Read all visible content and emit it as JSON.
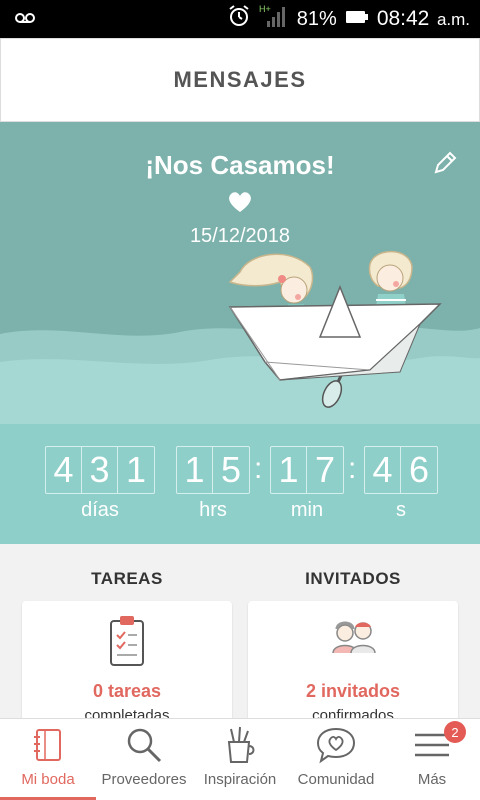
{
  "statusbar": {
    "battery": "81%",
    "time": "08:42",
    "ampm": "a.m."
  },
  "header": {
    "title": "MENSAJES"
  },
  "hero": {
    "headline": "¡Nos Casamos!",
    "date": "15/12/2018"
  },
  "countdown": {
    "days": [
      "4",
      "3",
      "1"
    ],
    "hours": [
      "1",
      "5"
    ],
    "minutes": [
      "1",
      "7"
    ],
    "seconds": [
      "4",
      "6"
    ],
    "labels": {
      "days": "días",
      "hours": "hrs",
      "minutes": "min",
      "seconds": "s"
    }
  },
  "sections": {
    "tasks": {
      "title": "TAREAS",
      "count": "0 tareas",
      "sub": "completadas"
    },
    "guests": {
      "title": "INVITADOS",
      "count": "2 invitados",
      "sub": "confirmados"
    }
  },
  "nav": {
    "items": [
      {
        "label": "Mi boda",
        "icon": "notebook-icon"
      },
      {
        "label": "Proveedores",
        "icon": "search-icon"
      },
      {
        "label": "Inspiración",
        "icon": "pencil-cup-icon"
      },
      {
        "label": "Comunidad",
        "icon": "chat-heart-icon"
      },
      {
        "label": "Más",
        "icon": "menu-icon"
      }
    ],
    "badge": "2"
  },
  "colors": {
    "accent": "#e1685f",
    "teal": "#7db1ab",
    "teal_light": "#8ecfc9"
  }
}
